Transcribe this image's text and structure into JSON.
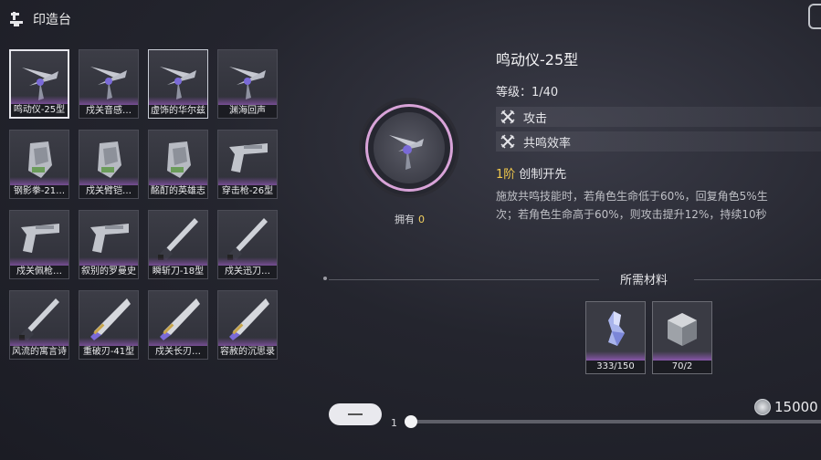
{
  "header": {
    "title": "印造台",
    "icon": "forge-icon"
  },
  "weapons": [
    {
      "name": "鸣动仪-25型",
      "icon": "rectifier-icon",
      "selected": true
    },
    {
      "name": "戍关音感…",
      "icon": "rectifier-icon"
    },
    {
      "name": "虚饰的华尔兹",
      "icon": "rectifier-icon",
      "highlight": true
    },
    {
      "name": "渊海回声",
      "icon": "rectifier-icon"
    },
    {
      "name": "钢影拳-21…",
      "icon": "gauntlet-icon"
    },
    {
      "name": "戍关臂铠…",
      "icon": "gauntlet-icon"
    },
    {
      "name": "酩酊的英雄志",
      "icon": "gauntlet-icon"
    },
    {
      "name": "穿击枪-26型",
      "icon": "pistol-icon"
    },
    {
      "name": "戍关佩枪…",
      "icon": "pistol-icon"
    },
    {
      "name": "叙别的罗曼史",
      "icon": "pistol-icon"
    },
    {
      "name": "瞬斩刀-18型",
      "icon": "sword-icon"
    },
    {
      "name": "戍关迅刀…",
      "icon": "sword-icon"
    },
    {
      "name": "风流的寓言诗",
      "icon": "sword-icon"
    },
    {
      "name": "重破刃-41型",
      "icon": "broadblade-icon"
    },
    {
      "name": "戍关长刃…",
      "icon": "broadblade-icon"
    },
    {
      "name": "容赦的沉思录",
      "icon": "broadblade-icon"
    }
  ],
  "selected": {
    "owned_label": "拥有",
    "owned_count": "0",
    "name": "鸣动仪-25型",
    "level": "等级：1/40",
    "stats": [
      {
        "label": "攻击",
        "icon": "crossed-swords-icon"
      },
      {
        "label": "共鸣效率",
        "icon": "crossed-swords-icon"
      }
    ],
    "skill_tier": "1阶",
    "skill_name": "创制开先",
    "desc_line1": "施放共鸣技能时，若角色生命低于60%，回复角色5%生",
    "desc_line2": "次；若角色生命高于60%，则攻击提升12%，持续10秒"
  },
  "materials": {
    "title": "所需材料",
    "items": [
      {
        "quantity": "333/150",
        "icon": "crystal-material-icon"
      },
      {
        "quantity": "70/2",
        "icon": "metal-cube-icon"
      }
    ]
  },
  "craft": {
    "quantity": "1",
    "quantity_fraction": 0.0,
    "cost": "15000",
    "currency_icon": "shell-credit-icon"
  },
  "colors": {
    "rarity_purple": "#a862d2",
    "accent_gold": "#f2c94c",
    "ring_pink": "#d8a3d8"
  }
}
